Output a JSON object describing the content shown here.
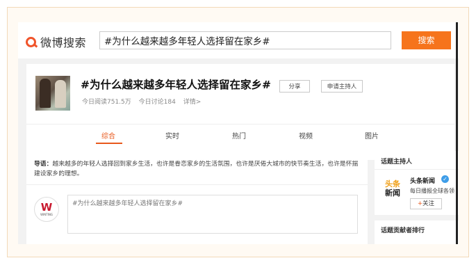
{
  "header": {
    "logo_text": "微博搜索",
    "search_value": "#为什么越来越多年轻人选择留在家乡#",
    "search_button": "搜索"
  },
  "topic": {
    "title": "#为什么越来越多年轻人选择留在家乡#",
    "share_label": "分享",
    "apply_host_label": "申请主持人",
    "read_today": "今日阅读751.5万",
    "discuss_today": "今日讨论184",
    "details_link": "详情>"
  },
  "tabs": [
    {
      "label": "综合",
      "active": true
    },
    {
      "label": "实时",
      "active": false
    },
    {
      "label": "热门",
      "active": false
    },
    {
      "label": "视频",
      "active": false
    },
    {
      "label": "图片",
      "active": false
    }
  ],
  "intro": {
    "label": "导语：",
    "text": "越来越多的年轻人选择回到家乡生活，也许是眷恋家乡的生活氛围，也许是厌倦大城市的快节奏生活，也许是怀揣建设家乡的理想。"
  },
  "composer": {
    "avatar_letter": "W",
    "avatar_caption": "WINTING",
    "placeholder": "#为什么越来越多年轻人选择留在家乡#"
  },
  "sidebar": {
    "host_title": "话题主持人",
    "host_logo_line1": "头条",
    "host_logo_line2": "新闻",
    "host_name": "头条新闻",
    "verified_mark": "✓",
    "host_desc": "每日播报全球各领",
    "follow_label": "关注",
    "contributors_title": "话题贡献者排行"
  },
  "colors": {
    "accent": "#f6741c",
    "active_tab": "#e8581c",
    "verified": "#3e9de8"
  }
}
